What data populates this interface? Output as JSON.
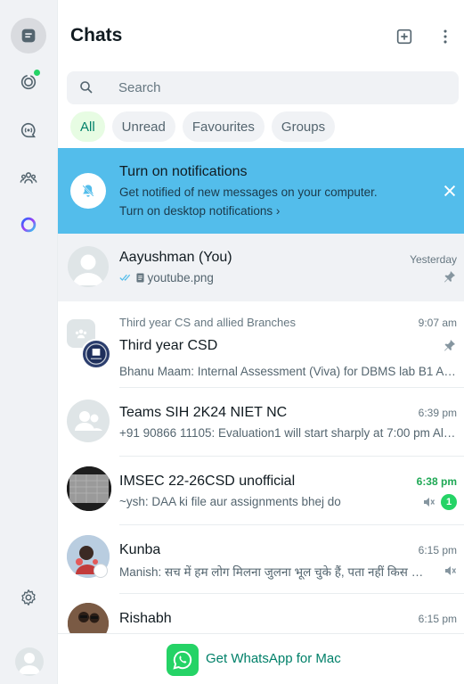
{
  "header": {
    "title": "Chats"
  },
  "search": {
    "placeholder": "Search",
    "value": ""
  },
  "filters": [
    {
      "label": "All",
      "active": true
    },
    {
      "label": "Unread",
      "active": false
    },
    {
      "label": "Favourites",
      "active": false
    },
    {
      "label": "Groups",
      "active": false
    }
  ],
  "notification": {
    "title": "Turn on notifications",
    "subtitle": "Get notified of new messages on your computer.",
    "link": "Turn on desktop notifications ›"
  },
  "chats": [
    {
      "name": "Aayushman (You)",
      "preview": "youtube.png",
      "time": "Yesterday",
      "pinned": true,
      "ticks": true,
      "doc_icon": true
    },
    {
      "community": "Third year CS and allied Branches",
      "name": "Third year CSD",
      "preview": "Bhanu Maam: Internal Assessment (Viva) for DBMS lab B1 AND ...",
      "time": "9:07 am",
      "pinned": true
    },
    {
      "name": "Teams SIH 2K24 NIET NC",
      "preview": "+91 90866 11105: Evaluation1 will start sharply at 7:00 pm All t...",
      "time": "6:39 pm"
    },
    {
      "name": "IMSEC 22-26CSD unofficial",
      "preview": "~ysh: DAA ki file aur assignments bhej do",
      "time": "6:38 pm",
      "unread_count": "1",
      "muted": true
    },
    {
      "name": "Kunba",
      "preview": "Manish: सच में हम लोग मिलना जुलना भूल चुके हैं, पता नहीं किस दौड़ मे ल...",
      "time": "6:15 pm",
      "muted": true
    },
    {
      "name": "Rishabh",
      "preview": "",
      "time": "6:15 pm"
    }
  ],
  "footer": {
    "label": "Get WhatsApp for Mac"
  },
  "colors": {
    "accent": "#25d366",
    "notification_bg": "#53bdeb",
    "rail_bg": "#f0f2f5",
    "unread_time": "#1fa855"
  }
}
